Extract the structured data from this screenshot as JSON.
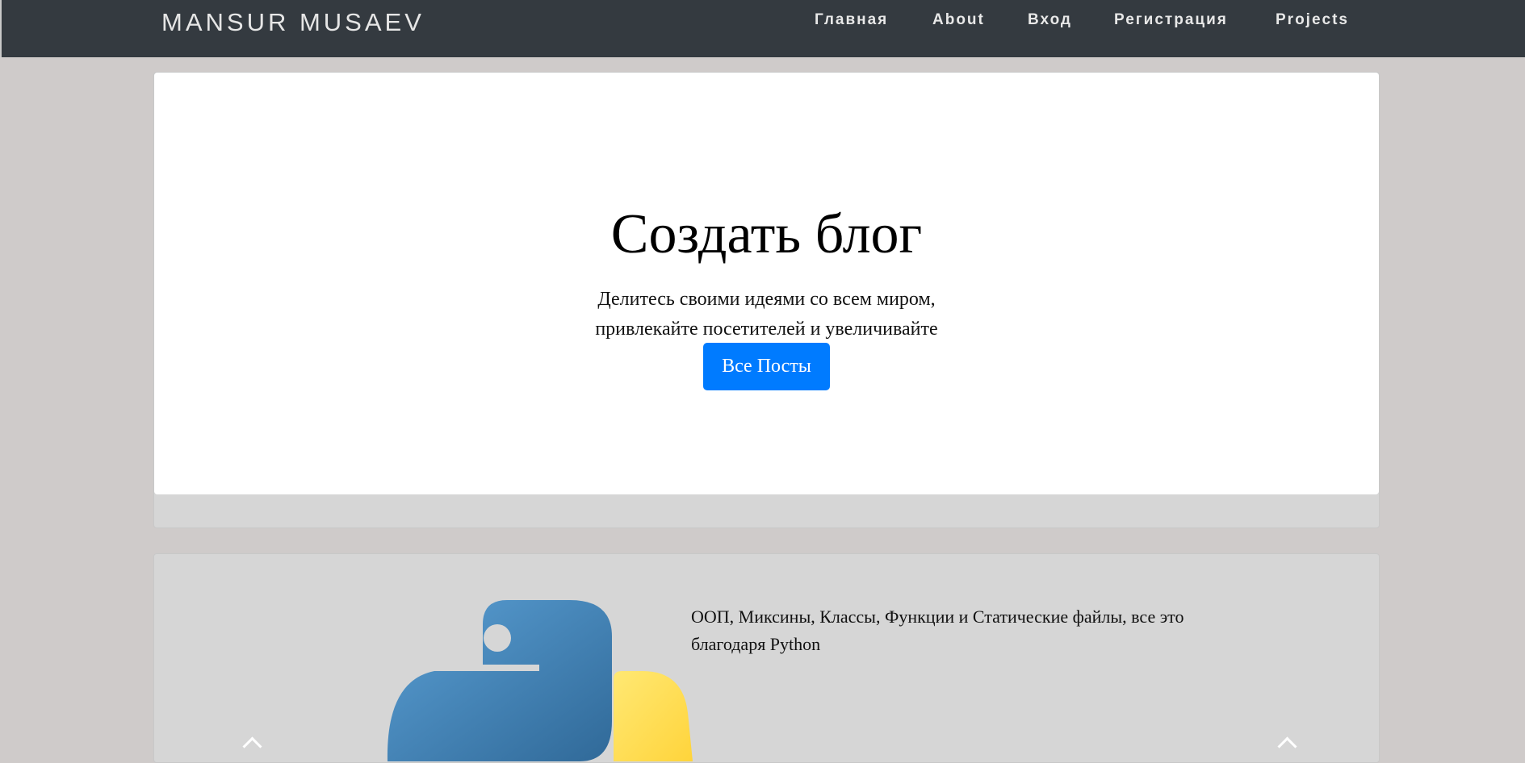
{
  "navbar": {
    "brand": "MANSUR MUSAEV",
    "links": [
      "Главная",
      "About",
      "Вход",
      "Регистрация",
      "Projects"
    ]
  },
  "hero": {
    "title": "Создать блог",
    "subtitle": "Делитесь своими идеями со всем миром, привлекайте посетителей и увеличивайте посещаемость.",
    "button_label": "Все Посты"
  },
  "feature": {
    "text": "ООП, Миксины, Классы, Функции и Статические файлы, все это благодаря Python",
    "logo_icon": "python-logo-icon"
  },
  "colors": {
    "navbar_bg": "#343a40",
    "page_bg": "#cfcbca",
    "button_bg": "#007bff",
    "python_blue": "#3c78aa",
    "python_yellow": "#ffd845"
  }
}
